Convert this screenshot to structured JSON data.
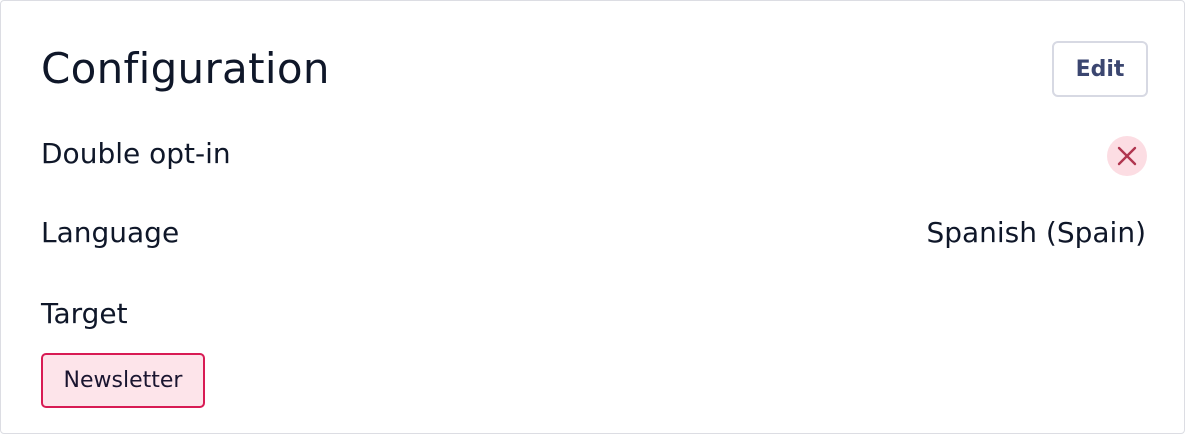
{
  "header": {
    "title": "Configuration",
    "edit_label": "Edit"
  },
  "rows": {
    "double_opt_in": {
      "label": "Double opt-in",
      "status_icon": "close-icon",
      "enabled": false
    },
    "language": {
      "label": "Language",
      "value": "Spanish (Spain)"
    },
    "target": {
      "label": "Target",
      "tags": [
        "Newsletter"
      ]
    }
  },
  "colors": {
    "status_negative_bg": "#fcdde3",
    "status_negative_icon": "#b0354f",
    "tag_border": "#d81b54",
    "tag_bg": "#fde4ea"
  }
}
